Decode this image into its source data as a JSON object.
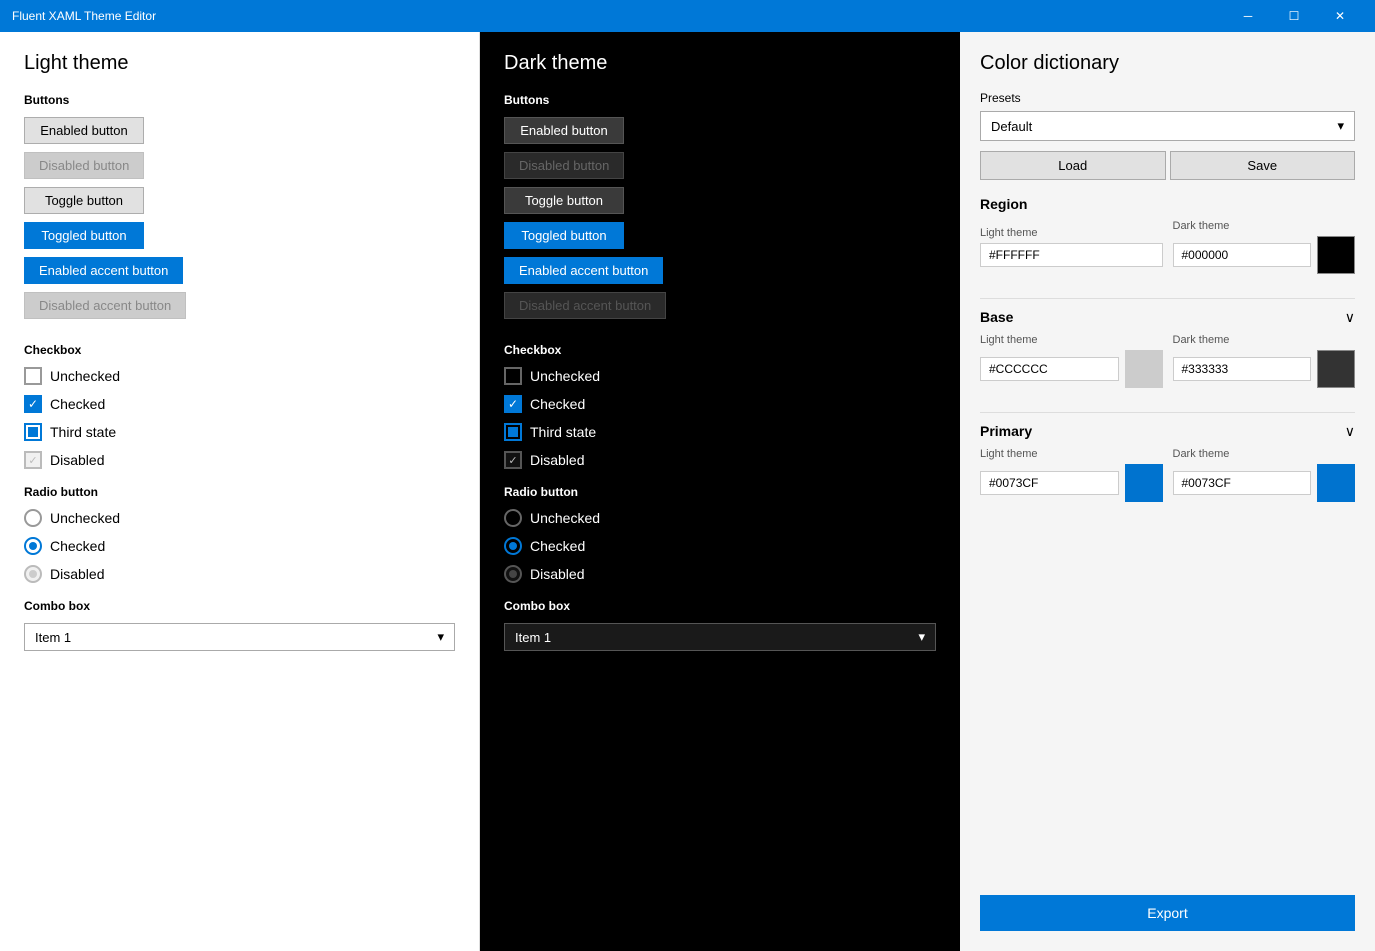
{
  "titleBar": {
    "title": "Fluent XAML Theme Editor",
    "minimizeLabel": "─",
    "maximizeLabel": "☐",
    "closeLabel": "✕"
  },
  "lightTheme": {
    "title": "Light theme",
    "buttons": {
      "sectionLabel": "Buttons",
      "enabled": "Enabled button",
      "disabled": "Disabled button",
      "toggle": "Toggle button",
      "toggled": "Toggled button",
      "accentEnabled": "Enabled accent button",
      "accentDisabled": "Disabled accent button"
    },
    "checkbox": {
      "sectionLabel": "Checkbox",
      "unchecked": "Unchecked",
      "checked": "Checked",
      "thirdState": "Third state",
      "disabled": "Disabled"
    },
    "radioButton": {
      "sectionLabel": "Radio button",
      "unchecked": "Unchecked",
      "checked": "Checked",
      "disabled": "Disabled"
    },
    "comboBox": {
      "sectionLabel": "Combo box",
      "value": "Item 1",
      "chevron": "▾"
    }
  },
  "darkTheme": {
    "title": "Dark theme",
    "buttons": {
      "sectionLabel": "Buttons",
      "enabled": "Enabled button",
      "disabled": "Disabled button",
      "toggle": "Toggle button",
      "toggled": "Toggled button",
      "accentEnabled": "Enabled accent button",
      "accentDisabled": "Disabled accent button"
    },
    "checkbox": {
      "sectionLabel": "Checkbox",
      "unchecked": "Unchecked",
      "checked": "Checked",
      "thirdState": "Third state",
      "disabled": "Disabled"
    },
    "radioButton": {
      "sectionLabel": "Radio button",
      "unchecked": "Unchecked",
      "checked": "Checked",
      "disabled": "Disabled"
    },
    "comboBox": {
      "sectionLabel": "Combo box",
      "value": "Item 1",
      "chevron": "▾"
    }
  },
  "colorDict": {
    "title": "Color dictionary",
    "presetsLabel": "Presets",
    "presetsValue": "Default",
    "loadLabel": "Load",
    "saveLabel": "Save",
    "region": {
      "title": "Region",
      "lightThemeLabel": "Light theme",
      "darkThemeLabel": "Dark theme",
      "lightValue": "#FFFFFF",
      "darkValue": "#000000",
      "lightSwatch": "#FFFFFF",
      "darkSwatch": "#000000"
    },
    "base": {
      "title": "Base",
      "lightThemeLabel": "Light theme",
      "darkThemeLabel": "Dark theme",
      "lightValue": "#CCCCCC",
      "darkValue": "#333333",
      "lightSwatch": "#CCCCCC",
      "darkSwatch": "#333333"
    },
    "primary": {
      "title": "Primary",
      "lightThemeLabel": "Light theme",
      "darkThemeLabel": "Dark theme",
      "lightValue": "#0073CF",
      "darkValue": "#0073CF",
      "lightSwatch": "#0073CF",
      "darkSwatch": "#0073CF"
    },
    "exportLabel": "Export"
  }
}
